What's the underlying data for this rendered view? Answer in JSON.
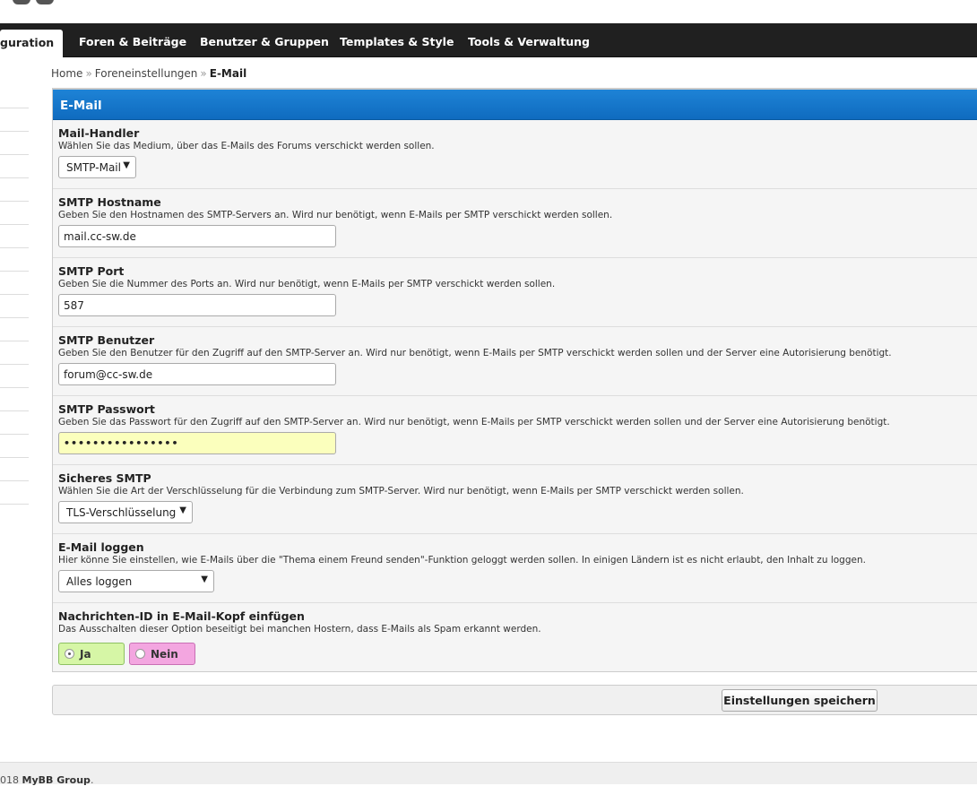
{
  "nav": {
    "items": [
      {
        "label": "guration",
        "active": true
      },
      {
        "label": "Foren & Beiträge"
      },
      {
        "label": "Benutzer & Gruppen"
      },
      {
        "label": "Templates & Style"
      },
      {
        "label": "Tools & Verwaltung"
      }
    ]
  },
  "breadcrumb": {
    "home": "Home",
    "section": "Foreneinstellungen",
    "current": "E-Mail",
    "separator": "»"
  },
  "panel": {
    "title": "E-Mail"
  },
  "settings": [
    {
      "title": "Mail-Handler",
      "desc": "Wählen Sie das Medium, über das E-Mails des Forums verschickt werden sollen.",
      "value": "SMTP-Mail"
    },
    {
      "title": "SMTP Hostname",
      "desc": "Geben Sie den Hostnamen des SMTP-Servers an. Wird nur benötigt, wenn E-Mails per SMTP verschickt werden sollen.",
      "value": "mail.cc-sw.de"
    },
    {
      "title": "SMTP Port",
      "desc": "Geben Sie die Nummer des Ports an. Wird nur benötigt, wenn E-Mails per SMTP verschickt werden sollen.",
      "value": "587"
    },
    {
      "title": "SMTP Benutzer",
      "desc": "Geben Sie den Benutzer für den Zugriff auf den SMTP-Server an. Wird nur benötigt, wenn E-Mails per SMTP verschickt werden sollen und der Server eine Autorisierung benötigt.",
      "value": "forum@cc-sw.de"
    },
    {
      "title": "SMTP Passwort",
      "desc": "Geben Sie das Passwort für den Zugriff auf den SMTP-Server an. Wird nur benötigt, wenn E-Mails per SMTP verschickt werden sollen und der Server eine Autorisierung benötigt.",
      "value": "••••••••••••••••"
    },
    {
      "title": "Sicheres SMTP",
      "desc": "Wählen Sie die Art der Verschlüsselung für die Verbindung zum SMTP-Server. Wird nur benötigt, wenn E-Mails per SMTP verschickt werden sollen.",
      "value": "TLS-Verschlüsselung"
    },
    {
      "title": "E-Mail loggen",
      "desc": "Hier könne Sie einstellen, wie E-Mails über die \"Thema einem Freund senden\"-Funktion geloggt werden sollen. In einigen Ländern ist es nicht erlaubt, den Inhalt zu loggen.",
      "value": "Alles loggen"
    },
    {
      "title": "Nachrichten-ID in E-Mail-Kopf einfügen",
      "desc": "Das Ausschalten dieser Option beseitigt bei manchen Hostern, dass E-Mails als Spam erkannt werden.",
      "yes": "Ja",
      "no": "Nein",
      "selected": "Ja"
    }
  ],
  "save": {
    "label": "Einstellungen speichern"
  },
  "footer": {
    "prefix": "018 ",
    "brand": "MyBB Group",
    "suffix": "."
  },
  "colors": {
    "header_blue": "#0f6bbf",
    "nav_bg": "#202020",
    "yes_green": "#d6f6a6",
    "no_pink": "#f3a6e0",
    "password_bg": "#fbffbd"
  }
}
